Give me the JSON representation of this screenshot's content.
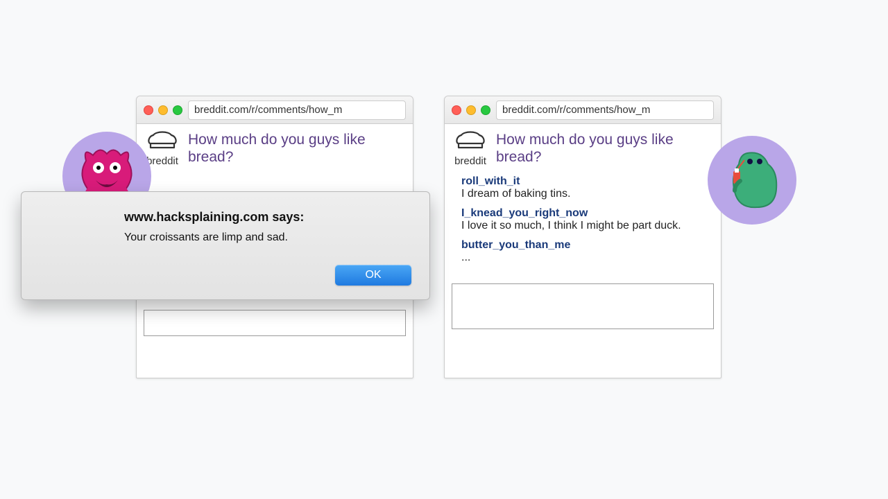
{
  "left_window": {
    "url": "breddit.com/r/comments/how_m",
    "site_label": "breddit",
    "title": "How much do you guys like bread?"
  },
  "right_window": {
    "url": "breddit.com/r/comments/how_m",
    "site_label": "breddit",
    "title": "How much do you guys like bread?",
    "comments": [
      {
        "user": "roll_with_it",
        "text": "I dream of baking tins."
      },
      {
        "user": "I_knead_you_right_now",
        "text": "I love it so much, I think I might be part duck."
      },
      {
        "user": "butter_you_than_me",
        "text": "..."
      }
    ]
  },
  "alert": {
    "title": "www.hacksplaining.com says:",
    "message": "Your croissants are limp and sad.",
    "ok_label": "OK"
  }
}
